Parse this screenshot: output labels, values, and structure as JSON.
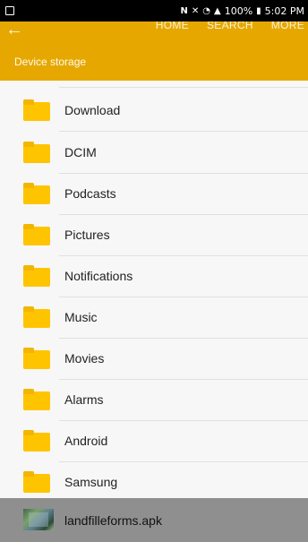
{
  "status_bar": {
    "icons": [
      "nfc-icon",
      "vibrate-icon",
      "wifi-icon",
      "signal-icon",
      "battery-icon"
    ],
    "battery_percent": "100%",
    "time": "5:02 PM"
  },
  "app_bar": {
    "color": "#e6a800",
    "back_icon": "back-arrow-icon",
    "actions": [
      "HOME",
      "SEARCH",
      "MORE"
    ],
    "path": "Device storage"
  },
  "folders": [
    {
      "name": "Download"
    },
    {
      "name": "DCIM"
    },
    {
      "name": "Podcasts"
    },
    {
      "name": "Pictures"
    },
    {
      "name": "Notifications"
    },
    {
      "name": "Music"
    },
    {
      "name": "Movies"
    },
    {
      "name": "Alarms"
    },
    {
      "name": "Android"
    },
    {
      "name": "Samsung"
    }
  ],
  "bottom_item": {
    "file_name": "landfilleforms.apk"
  }
}
